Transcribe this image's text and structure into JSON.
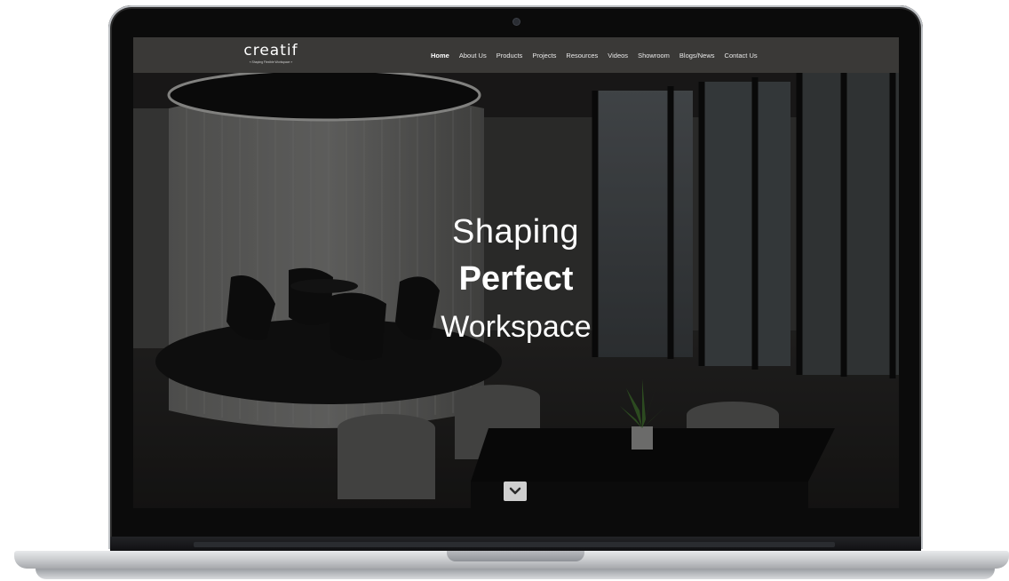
{
  "logo": {
    "word": "creatif",
    "tagline": "« Shaping Flexible Workspace »"
  },
  "nav": {
    "items": [
      {
        "label": "Home",
        "active": true
      },
      {
        "label": "About Us"
      },
      {
        "label": "Products"
      },
      {
        "label": "Projects"
      },
      {
        "label": "Resources"
      },
      {
        "label": "Videos"
      },
      {
        "label": "Showroom"
      },
      {
        "label": "Blogs/News"
      },
      {
        "label": "Contact Us"
      }
    ]
  },
  "hero": {
    "line1": "Shaping",
    "line2": "Perfect",
    "line3": "Workspace"
  },
  "icons": {
    "scroll": "chevron-down-icon"
  },
  "colors": {
    "navbar": "#3a3937",
    "hero_text": "#ffffff",
    "scroll_button": "#cfcfcf"
  }
}
